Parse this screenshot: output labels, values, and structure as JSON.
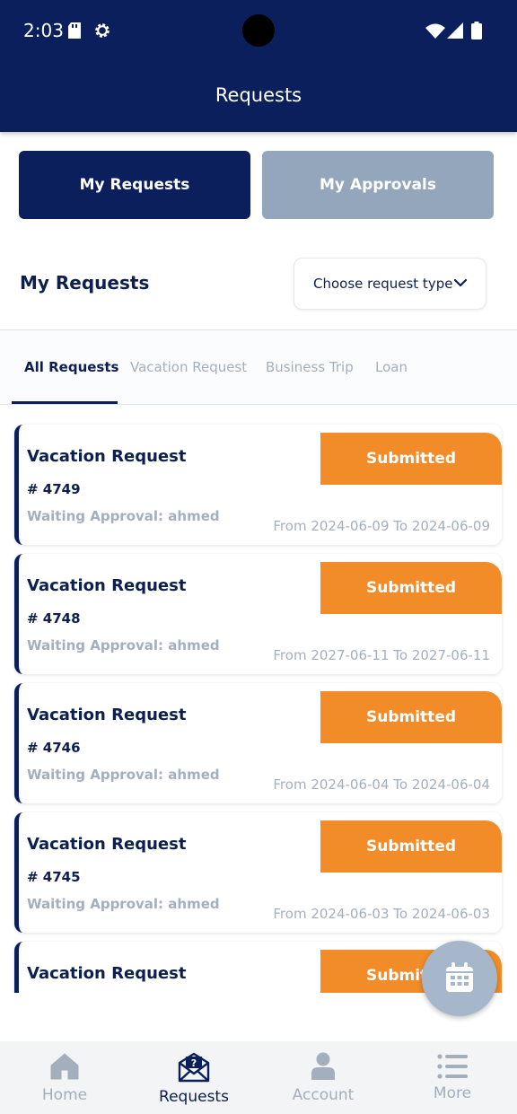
{
  "status_bar": {
    "time": "2:03"
  },
  "header": {
    "title": "Requests"
  },
  "segments": {
    "my_requests": "My Requests",
    "my_approvals": "My Approvals"
  },
  "section": {
    "title": "My Requests",
    "request_type_placeholder": "Choose request type"
  },
  "tabs": [
    {
      "label": "All Requests",
      "active": true
    },
    {
      "label": "Vacation Request",
      "active": false
    },
    {
      "label": "Business Trip",
      "active": false
    },
    {
      "label": "Loan",
      "active": false
    }
  ],
  "requests": [
    {
      "title": "Vacation Request",
      "number": "# 4749",
      "waiting": "Waiting Approval: ahmed",
      "status": "Submitted",
      "dates": "From 2024-06-09 To 2024-06-09"
    },
    {
      "title": "Vacation Request",
      "number": "# 4748",
      "waiting": "Waiting Approval: ahmed",
      "status": "Submitted",
      "dates": "From 2027-06-11 To 2027-06-11"
    },
    {
      "title": "Vacation Request",
      "number": "# 4746",
      "waiting": "Waiting Approval: ahmed",
      "status": "Submitted",
      "dates": "From 2024-06-04 To 2024-06-04"
    },
    {
      "title": "Vacation Request",
      "number": "# 4745",
      "waiting": "Waiting Approval: ahmed",
      "status": "Submitted",
      "dates": "From 2024-06-03 To 2024-06-03"
    },
    {
      "title": "Vacation Request",
      "number": "",
      "waiting": "",
      "status": "Submitted",
      "dates": ""
    }
  ],
  "fab": {
    "icon": "calendar-icon"
  },
  "bottom_nav": [
    {
      "label": "Home",
      "icon": "home-icon",
      "active": false
    },
    {
      "label": "Requests",
      "icon": "mail-question-icon",
      "active": true
    },
    {
      "label": "Account",
      "icon": "person-icon",
      "active": false
    },
    {
      "label": "More",
      "icon": "menu-list-icon",
      "active": false
    }
  ],
  "colors": {
    "primary": "#0b1f5c",
    "secondary": "#94a6bc",
    "status_submitted": "#f28c28",
    "muted": "#a4afbd"
  }
}
